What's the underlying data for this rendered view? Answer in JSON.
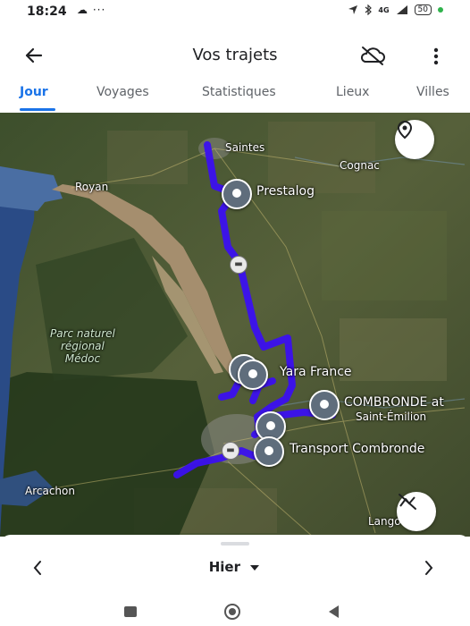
{
  "status_bar": {
    "time": "18:24",
    "left_icons": "☁ ···",
    "network": "4G",
    "battery": "50"
  },
  "header": {
    "title": "Vos trajets"
  },
  "tabs": [
    {
      "label": "Jour",
      "active": true
    },
    {
      "label": "Voyages",
      "active": false
    },
    {
      "label": "Statistiques",
      "active": false
    },
    {
      "label": "Lieux",
      "active": false
    },
    {
      "label": "Villes",
      "active": false
    }
  ],
  "map": {
    "labels": {
      "saintes": "Saintes",
      "cognac": "Cognac",
      "royan": "Royan",
      "prestalog": "Prestalog",
      "yara": "Yara France",
      "combronde": "COMBRONDE at",
      "saint_emilion": "Saint-Émilion",
      "transport_combronde": "Transport Combronde",
      "arcachon": "Arcachon",
      "langon": "Lango",
      "park_line1": "Parc naturel",
      "park_line2": "régional",
      "park_line3": "Médoc"
    },
    "route_color": "#3b10f0",
    "accent_color": "#1a73e8"
  },
  "bottom_sheet": {
    "day_label": "Hier"
  }
}
